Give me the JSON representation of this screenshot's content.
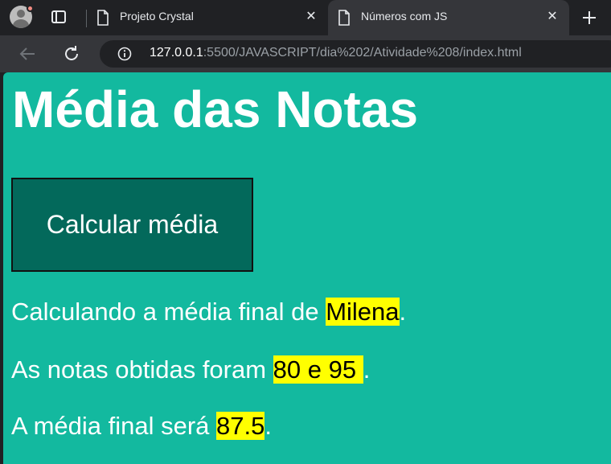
{
  "browser": {
    "tabs": [
      {
        "title": "Projeto Crystal",
        "active": false
      },
      {
        "title": "Números com JS",
        "active": true
      }
    ],
    "url_host": "127.0.0.1",
    "url_path": ":5500/JAVASCRIPT/dia%202/Atividade%208/index.html"
  },
  "page": {
    "title": "Média das Notas",
    "button_label": "Calcular média",
    "line1": {
      "prefix": "Calculando a média final de ",
      "highlight": "Milena",
      "suffix": "."
    },
    "line2": {
      "prefix": "As notas obtidas foram ",
      "highlight": "80 e 95 ",
      "suffix": "."
    },
    "line3": {
      "prefix": "A média final será ",
      "highlight": "87.5",
      "suffix": "."
    }
  },
  "colors": {
    "page_background": "#13b99f",
    "button_background": "#03695b",
    "highlight": "#ffff00"
  }
}
